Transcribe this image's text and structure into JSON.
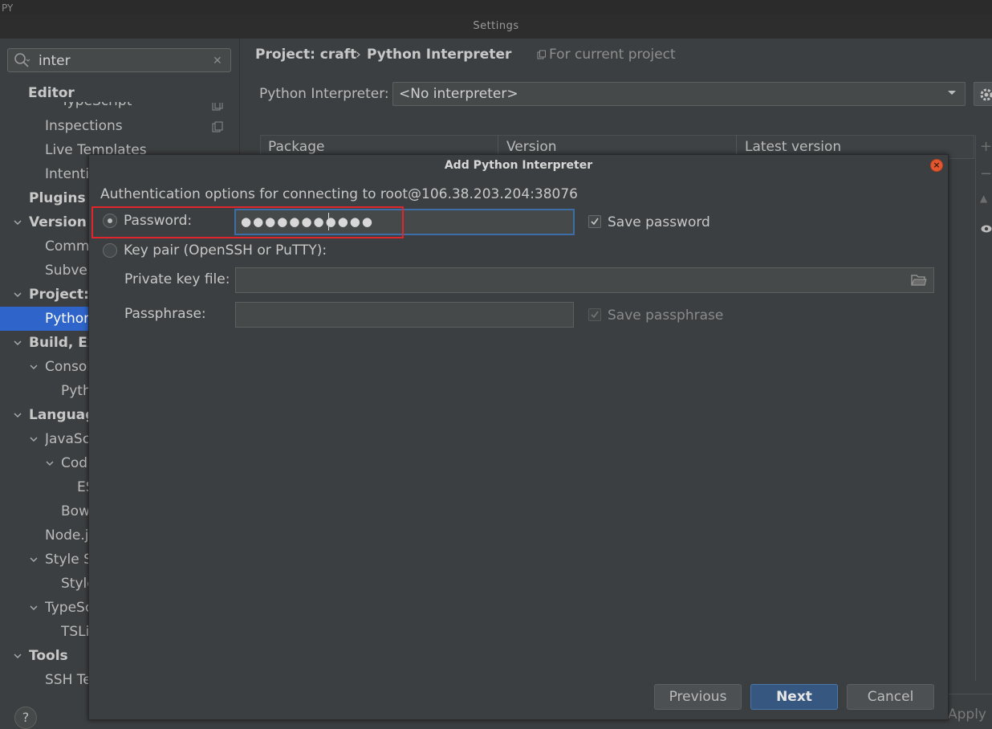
{
  "window": {
    "app_label": "PY",
    "title": "Settings"
  },
  "sidebar": {
    "search_value": "inter",
    "items": [
      {
        "label": "Editor"
      },
      {
        "label": "TypeScript"
      },
      {
        "label": "Inspections"
      },
      {
        "label": "Live Templates"
      },
      {
        "label": "Intentions"
      },
      {
        "label": "Plugins"
      },
      {
        "label": "Version Control"
      },
      {
        "label": "Commit"
      },
      {
        "label": "Subversion"
      },
      {
        "label": "Project: craft"
      },
      {
        "label": "Python Interpreter"
      },
      {
        "label": "Build, Execution, Deployment"
      },
      {
        "label": "Console"
      },
      {
        "label": "Python Console"
      },
      {
        "label": "Languages & Frameworks"
      },
      {
        "label": "JavaScript"
      },
      {
        "label": "Code Quality Tools"
      },
      {
        "label": "ESLint"
      },
      {
        "label": "Bower"
      },
      {
        "label": "Node.js"
      },
      {
        "label": "Style Sheets"
      },
      {
        "label": "Stylelint"
      },
      {
        "label": "TypeScript"
      },
      {
        "label": "TSLint"
      },
      {
        "label": "Tools"
      },
      {
        "label": "SSH Terminal"
      }
    ]
  },
  "main": {
    "breadcrumb": {
      "project": "Project: craft",
      "separator": "›",
      "page": "Python Interpreter",
      "scope": "For current project"
    },
    "interpreter": {
      "label": "Python Interpreter:",
      "value": "<No interpreter>"
    },
    "table": {
      "columns": [
        "Package",
        "Version",
        "Latest version"
      ]
    },
    "apply_label": "Apply",
    "help_label": "?"
  },
  "dialog": {
    "title": "Add Python Interpreter",
    "auth_text": "Authentication options for connecting to root@106.38.203.204:38076",
    "password": {
      "label": "Password:",
      "value": "●●●●●●●●●●●",
      "selected": true
    },
    "save_password": {
      "label": "Save password",
      "checked": true
    },
    "keypair": {
      "label": "Key pair (OpenSSH or PuTTY):",
      "selected": false
    },
    "private_key": {
      "label": "Private key file:",
      "value": ""
    },
    "passphrase": {
      "label": "Passphrase:",
      "value": ""
    },
    "save_passphrase": {
      "label": "Save passphrase",
      "checked": true,
      "disabled": true
    },
    "buttons": {
      "previous": "Previous",
      "next": "Next",
      "cancel": "Cancel"
    }
  },
  "colors": {
    "accent": "#2f65ca",
    "primary_button": "#365880",
    "highlight": "#e0262a",
    "background": "#3c3f41"
  }
}
